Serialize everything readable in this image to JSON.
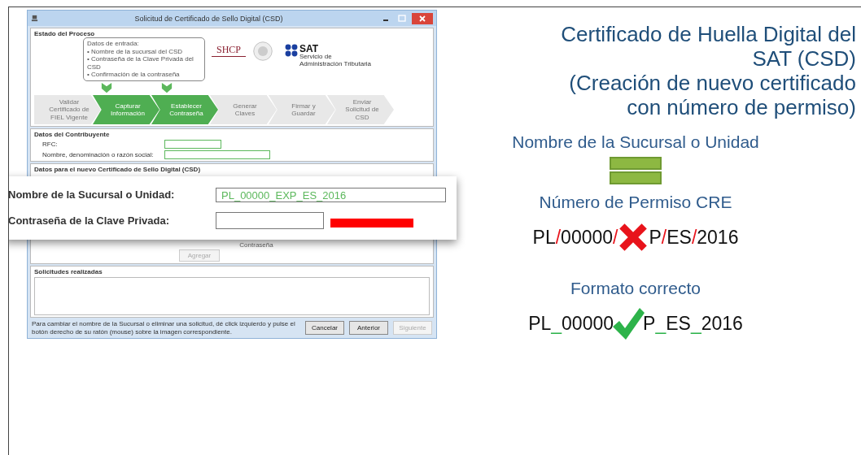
{
  "window": {
    "title": "Solicitud de Certificado de Sello Digital (CSD)"
  },
  "process": {
    "heading": "Estado del Proceso",
    "callout": [
      "Datos de entrada:",
      "• Nombre de la sucursal del CSD",
      "• Contraseña de la Clave Privada del CSD",
      "• Confirmación de la contraseña"
    ],
    "shcp": "SHCP",
    "sat": "SAT",
    "sat_caption": "Servicio de Administración Tributaria",
    "steps": [
      {
        "label": "Validar Certificado de FIEL Vigente",
        "active": false
      },
      {
        "label": "Capturar Información",
        "active": true
      },
      {
        "label": "Establecer Contraseña",
        "active": true
      },
      {
        "label": "Generar Claves",
        "active": false
      },
      {
        "label": "Firmar y Guardar",
        "active": false
      },
      {
        "label": "Enviar Solicitud de CSD",
        "active": false
      }
    ]
  },
  "taxpayer": {
    "heading": "Datos del Contribuyente",
    "fields": [
      {
        "label": "RFC:"
      },
      {
        "label": "Nombre, denominación o razón social:"
      }
    ]
  },
  "new_certificate": {
    "heading": "Datos para el nuevo Certificado de Sello Digital (CSD)",
    "hint": "Contraseña",
    "add_button": {
      "label": "Agregar",
      "disabled": true
    }
  },
  "zoom_panel": {
    "branch_label": "Nombre de la Sucursal o Unidad:",
    "branch_value": "PL_00000_EXP_ES_2016",
    "password_label": "Contraseña de la Clave Privada:"
  },
  "requests": {
    "heading": "Solicitudes realizadas"
  },
  "footer": {
    "note": "Para cambiar el nombre de la Sucursal o eliminar una solicitud, dé click izquierdo y pulse el botón derecho de su ratón (mouse) sobre la imagen correspondiente.",
    "buttons": [
      {
        "label": "Cancelar",
        "disabled": false
      },
      {
        "label": "Anterior",
        "disabled": false
      },
      {
        "label": "Siguiente",
        "disabled": true
      }
    ]
  },
  "slide": {
    "title_lines": [
      "Certificado de Huella Digital del",
      "SAT (CSD)",
      "(Creación de nuevo certificado",
      "con número de permiso)"
    ],
    "branch_heading": "Nombre de la Sucursal o Unidad",
    "permit_heading": "Número de Permiso CRE",
    "wrong_example": {
      "before": [
        {
          "text": "PL",
          "kind": "plain"
        },
        {
          "text": "/",
          "kind": "sep"
        },
        {
          "text": "00000",
          "kind": "plain"
        },
        {
          "text": "/",
          "kind": "sep"
        }
      ],
      "after": [
        {
          "text": "P",
          "kind": "plain"
        },
        {
          "text": "/",
          "kind": "sep"
        },
        {
          "text": "ES",
          "kind": "plain"
        },
        {
          "text": "/",
          "kind": "sep"
        },
        {
          "text": "2016",
          "kind": "plain"
        }
      ]
    },
    "correct_heading": "Formato correcto",
    "correct_example": {
      "before": [
        {
          "text": "PL",
          "kind": "plain"
        },
        {
          "text": "_",
          "kind": "sep"
        },
        {
          "text": "00000",
          "kind": "plain"
        }
      ],
      "after": [
        {
          "text": "P",
          "kind": "plain"
        },
        {
          "text": "_",
          "kind": "sep"
        },
        {
          "text": "ES",
          "kind": "plain"
        },
        {
          "text": "_",
          "kind": "sep"
        },
        {
          "text": "2016",
          "kind": "plain"
        }
      ]
    }
  }
}
